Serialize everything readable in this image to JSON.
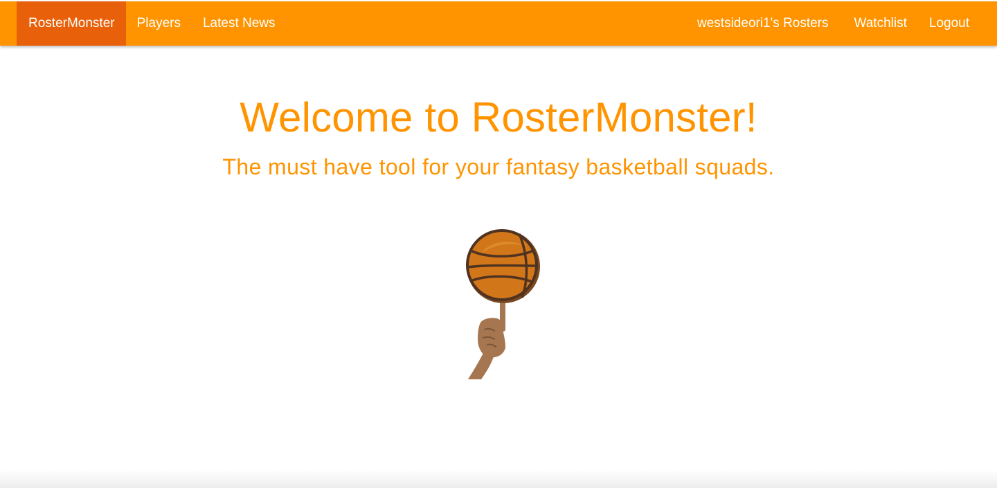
{
  "navbar": {
    "brand": "RosterMonster",
    "left_items": [
      {
        "label": "Players"
      },
      {
        "label": "Latest News"
      }
    ],
    "right_items": [
      {
        "label": "westsideori1's Rosters"
      },
      {
        "label": "Watchlist"
      },
      {
        "label": "Logout"
      }
    ]
  },
  "hero": {
    "title": "Welcome to RosterMonster!",
    "subtitle": "The must have tool for your fantasy basketball squads."
  },
  "illustration": {
    "icon": "spinning-basketball-on-finger-icon"
  },
  "colors": {
    "navbar_bg": "#ff9400",
    "brand_bg": "#e8610a",
    "accent_text": "#ff9400",
    "ball": "#d2761a",
    "skin": "#a5764f"
  }
}
